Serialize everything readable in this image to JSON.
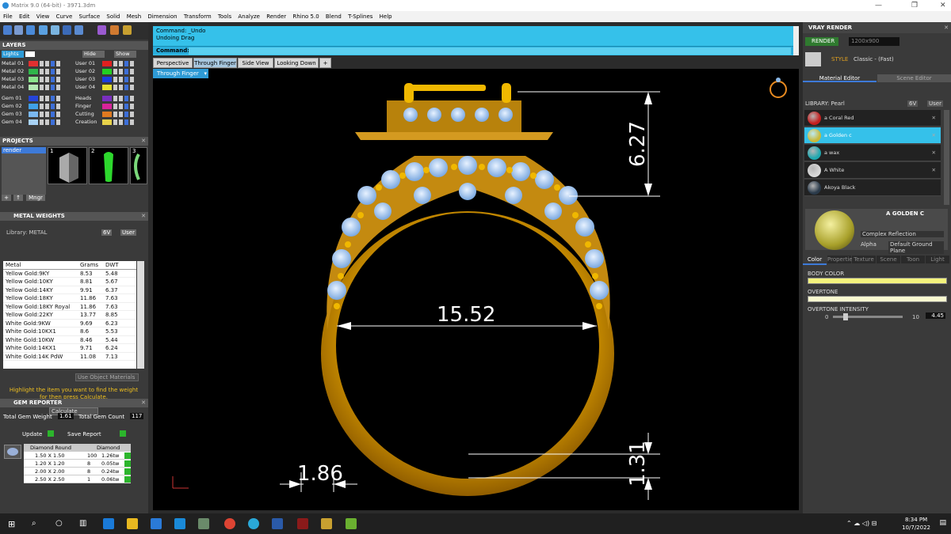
{
  "window": {
    "title": "Matrix 9.0 (64-bit) - 3971.3dm",
    "controls": [
      "—",
      "❐",
      "✕"
    ]
  },
  "menu": [
    "File",
    "Edit",
    "View",
    "Curve",
    "Surface",
    "Solid",
    "Mesh",
    "Dimension",
    "Transform",
    "Tools",
    "Analyze",
    "Render",
    "Rhino 5.0",
    "Blend",
    "T-Splines",
    "Help"
  ],
  "layers": {
    "title": "LAYERS",
    "top_row": {
      "lights": "Lights",
      "hide": "Hide",
      "show": "Show"
    },
    "left": [
      {
        "name": "Metal 01",
        "color": "#e03030"
      },
      {
        "name": "Metal 02",
        "color": "#2fb54a"
      },
      {
        "name": "Metal 03",
        "color": "#8ae38c"
      },
      {
        "name": "Metal 04",
        "color": "#b4e8b4"
      },
      {
        "name": "Gem 01",
        "color": "#2544d8"
      },
      {
        "name": "Gem 02",
        "color": "#3fa0e8"
      },
      {
        "name": "Gem 03",
        "color": "#7ab8f0"
      },
      {
        "name": "Gem 04",
        "color": "#a8d2f5"
      }
    ],
    "right": [
      {
        "name": "User 01",
        "color": "#e02020"
      },
      {
        "name": "User 02",
        "color": "#22d022"
      },
      {
        "name": "User 03",
        "color": "#1a3ee0"
      },
      {
        "name": "User 04",
        "color": "#e6e030"
      },
      {
        "name": "Heads",
        "color": "#7a2fbf"
      },
      {
        "name": "Finger",
        "color": "#d8239a"
      },
      {
        "name": "Cutting",
        "color": "#e07a20"
      },
      {
        "name": "Creation",
        "color": "#e8d24a"
      }
    ]
  },
  "projects": {
    "title": "PROJECTS",
    "items": [
      "render"
    ],
    "thumbs": [
      "1",
      "2",
      "3"
    ],
    "buttons": {
      "add": "+",
      "up": "↑",
      "mngr": "Mngr"
    }
  },
  "metal_weights": {
    "title": "METAL WEIGHTS",
    "library_label": "Library: METAL",
    "tabs": [
      "6V",
      "User"
    ],
    "columns": [
      "Metal",
      "Grams",
      "DWT"
    ],
    "rows": [
      [
        "Yellow Gold:9KY",
        "8.53",
        "5.48"
      ],
      [
        "Yellow Gold:10KY",
        "8.81",
        "5.67"
      ],
      [
        "Yellow Gold:14KY",
        "9.91",
        "6.37"
      ],
      [
        "Yellow Gold:18KY",
        "11.86",
        "7.63"
      ],
      [
        "Yellow Gold:18KY Royal",
        "11.86",
        "7.63"
      ],
      [
        "Yellow Gold:22KY",
        "13.77",
        "8.85"
      ],
      [
        "White Gold:9KW",
        "9.69",
        "6.23"
      ],
      [
        "White Gold:10KX1",
        "8.6",
        "5.53"
      ],
      [
        "White Gold:10KW",
        "8.46",
        "5.44"
      ],
      [
        "White Gold:14KX1",
        "9.71",
        "6.24"
      ],
      [
        "White Gold:14K PdW",
        "11.08",
        "7.13"
      ]
    ],
    "use_object_materials": "Use Object Materials",
    "hint": "Highlight the item you want to find the weight for then press Calculate.",
    "calculate": "Calculate"
  },
  "gem_reporter": {
    "title": "GEM REPORTER",
    "total_weight_label": "Total Gem Weight",
    "total_weight": "1.61",
    "total_count_label": "Total Gem Count",
    "total_count": "117",
    "update": "Update",
    "save_report": "Save Report",
    "columns": [
      "Diamond Round",
      "Diamond"
    ],
    "rows": [
      [
        "1.50 X 1.50",
        "100",
        "1.26tw"
      ],
      [
        "1.20 X 1.20",
        "8",
        "0.05tw"
      ],
      [
        "2.00 X 2.00",
        "8",
        "0.24tw"
      ],
      [
        "2.50 X 2.50",
        "1",
        "0.06tw"
      ]
    ]
  },
  "command": {
    "line1": "Command: _Undo",
    "line2": "Undoing Drag",
    "prompt": "Command:"
  },
  "view_tabs": [
    "Perspective",
    "Through Finger",
    "Side View",
    "Looking Down",
    "+"
  ],
  "active_view": "Through Finger",
  "viewport": {
    "dimensions": {
      "height_top": "6.27",
      "inner_width": "15.52",
      "shank_width": "1.86",
      "shank_bottom": "1.31"
    }
  },
  "vray": {
    "title": "VRAY RENDER",
    "render_btn": "RENDER",
    "resolution": "1200x900",
    "style_label": "STYLE",
    "style_value": "Classic - (Fast)",
    "tabs": [
      "Material Editor",
      "Scene Editor"
    ],
    "library_label": "LIBRARY: Pearl",
    "lib_tabs": [
      "6V",
      "User"
    ],
    "materials": [
      {
        "name": "a Coral Red",
        "color": "#c41e1e"
      },
      {
        "name": "a Golden c",
        "color": "#c9b93a"
      },
      {
        "name": "a wax",
        "color": "#1fa8b0"
      },
      {
        "name": "A White",
        "color": "#d8d8d8"
      },
      {
        "name": "Akoya Black",
        "color": "#2a3a4a"
      }
    ],
    "selected_material": "A GOLDEN C",
    "reflection": "Complex Reflection",
    "alpha_label": "Alpha",
    "ground": "Default Ground Plane",
    "prop_tabs": [
      "Color",
      "Properties",
      "Texture",
      "Scene",
      "Toon",
      "Light"
    ],
    "body_color_label": "BODY COLOR",
    "overtone_label": "OVERTONE",
    "overtone_intensity_label": "OVERTONE INTENSITY",
    "intensity_min": "0",
    "intensity_max": "10",
    "intensity_value": "4.45"
  },
  "taskbar": {
    "time": "8:34 PM",
    "date": "10/7/2022"
  }
}
